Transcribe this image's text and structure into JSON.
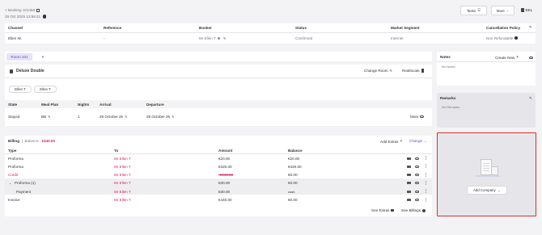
{
  "header": {
    "back_label": "< Booking 101456",
    "timestamp": "29 Oct 2025 13:58:41",
    "tasks_label": "Tasks",
    "more_label": "More",
    "lang_label": "BEL"
  },
  "booking": {
    "columns": [
      "Channel",
      "Reference",
      "Booker",
      "Status",
      "Market Segment",
      "Cancellation Policy"
    ],
    "values": {
      "channel": "Ellen W.",
      "reference": "-",
      "booker": "Mr Ellen T",
      "status": "Confirmed",
      "market_segment": "Internet",
      "cancellation_policy": "Non Refundable"
    }
  },
  "rooms": {
    "tab_label": "Room 101",
    "add_tab_label": "+",
    "room_type": "Deluxe Double",
    "change_room_label": "Change Room",
    "reallocate_label": "Reallocate",
    "guests": [
      "Ellen T",
      "Ellen T"
    ],
    "columns": [
      "State",
      "Meal Plan",
      "Nights",
      "Arrival",
      "Departure"
    ],
    "row": {
      "state": "Stayed",
      "meal_plan": "BB",
      "nights": "1",
      "arrival": "28 October 25",
      "departure": "29 October 25",
      "more_label": "More"
    }
  },
  "billing": {
    "title": "Billing",
    "balance_label": "Balance:",
    "balance_value": "€440.00",
    "add_extras_label": "Add Extras",
    "change_label": "Change",
    "columns": [
      "Type",
      "To",
      "Amount",
      "Balance"
    ],
    "rows": [
      {
        "type": "Proforma",
        "to": "Mr Ellen T",
        "amount": "€20.00",
        "balance": "€20.00",
        "kind": "normal"
      },
      {
        "type": "Proforma",
        "to": "Mr Ellen T",
        "amount": "€420.00",
        "balance": "€420.00",
        "kind": "normal"
      },
      {
        "type": "Credit",
        "to": "Mr Ellen T",
        "amount": "-€440.00",
        "balance": "€0.00",
        "kind": "credit"
      },
      {
        "type": "Proforma (1)",
        "to": "Mr Ellen T",
        "amount": "€30.00",
        "balance": "€0.00",
        "kind": "group"
      },
      {
        "type": "Payment",
        "to": "Mr Ellen T",
        "amount": "€30.00",
        "balance": "cash",
        "kind": "sub"
      },
      {
        "type": "Invoice",
        "to": "Mr Ellen T",
        "amount": "€440.00",
        "balance": "€0.00",
        "kind": "normal"
      }
    ],
    "see_extras_label": "See Extras",
    "see_billings_label": "See Billings"
  },
  "notes": {
    "title": "Notes",
    "create_label": "Create New",
    "empty_text": "No Notes"
  },
  "remarks": {
    "title": "Remarks",
    "empty_text": "No Remarks"
  },
  "company": {
    "add_label": "Add Company"
  },
  "colors": {
    "accent_red": "#e0245e",
    "highlight_border": "#d9302c",
    "tab_active_bg": "#e6e3f7"
  }
}
